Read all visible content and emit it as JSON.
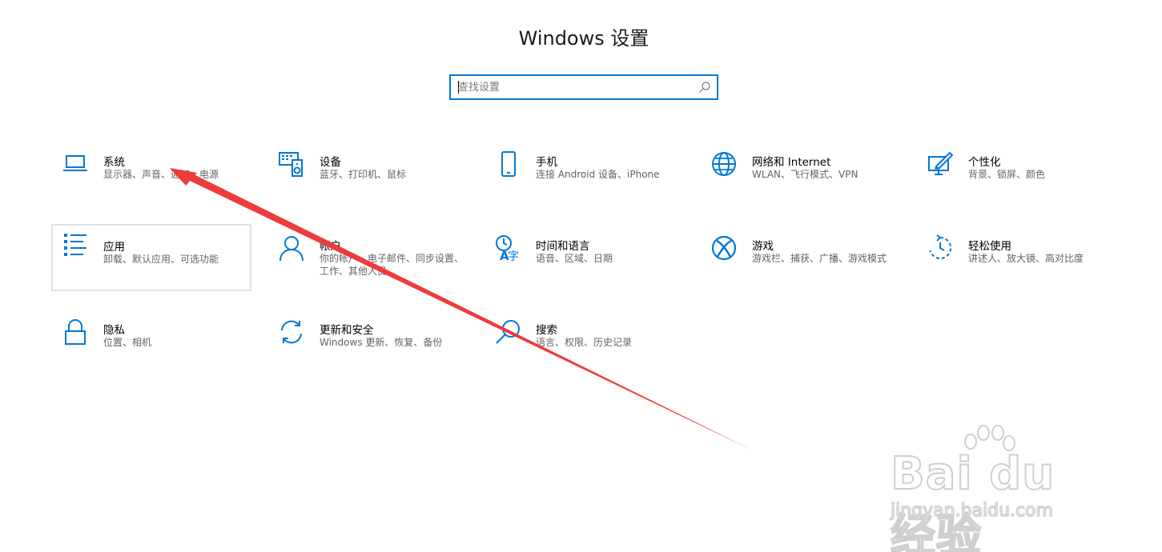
{
  "window": {
    "title": "Windows 设置"
  },
  "search": {
    "placeholder": "查找设置"
  },
  "tiles": [
    {
      "id": "system",
      "title": "系统",
      "desc": "显示器、声音、通知、电源",
      "icon": "laptop-icon",
      "selected": false
    },
    {
      "id": "devices",
      "title": "设备",
      "desc": "蓝牙、打印机、鼠标",
      "icon": "devices-icon",
      "selected": false
    },
    {
      "id": "phone",
      "title": "手机",
      "desc": "连接 Android 设备、iPhone",
      "icon": "phone-icon",
      "selected": false
    },
    {
      "id": "network",
      "title": "网络和 Internet",
      "desc": "WLAN、飞行模式、VPN",
      "icon": "globe-icon",
      "selected": false
    },
    {
      "id": "personalization",
      "title": "个性化",
      "desc": "背景、锁屏、颜色",
      "icon": "personalization-icon",
      "selected": false
    },
    {
      "id": "apps",
      "title": "应用",
      "desc": "卸载、默认应用、可选功能",
      "icon": "apps-list-icon",
      "selected": true
    },
    {
      "id": "accounts",
      "title": "帐户",
      "desc": "你的帐户、电子邮件、同步设置、工作、其他人员",
      "icon": "person-icon",
      "selected": false
    },
    {
      "id": "time-language",
      "title": "时间和语言",
      "desc": "语音、区域、日期",
      "icon": "time-language-icon",
      "selected": false
    },
    {
      "id": "gaming",
      "title": "游戏",
      "desc": "游戏栏、捕获、广播、游戏模式",
      "icon": "xbox-icon",
      "selected": false
    },
    {
      "id": "ease-of-access",
      "title": "轻松使用",
      "desc": "讲述人、放大镜、高对比度",
      "icon": "ease-of-access-icon",
      "selected": false
    },
    {
      "id": "privacy",
      "title": "隐私",
      "desc": "位置、相机",
      "icon": "lock-icon",
      "selected": false
    },
    {
      "id": "update-security",
      "title": "更新和安全",
      "desc": "Windows 更新、恢复、备份",
      "icon": "sync-icon",
      "selected": false
    },
    {
      "id": "search",
      "title": "搜索",
      "desc": "语言、权限、历史记录",
      "icon": "search-icon",
      "selected": false
    }
  ],
  "colors": {
    "accent": "#0078d7",
    "arrow": "#ee3b3b",
    "watermark": "#cfcfcf"
  },
  "watermark": {
    "logo": "Bai du 经验",
    "url": "jingyan.baidu.com"
  }
}
